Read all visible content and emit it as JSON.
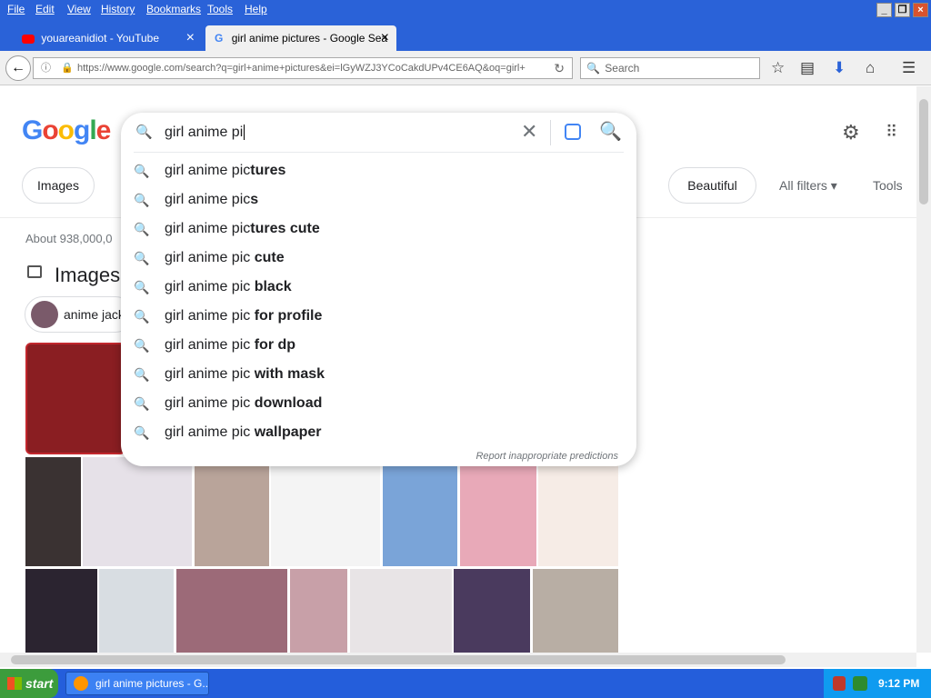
{
  "menubar": {
    "items": [
      "File",
      "Edit",
      "View",
      "History",
      "Bookmarks",
      "Tools",
      "Help"
    ]
  },
  "tabs": [
    {
      "title": "youareanidiot - YouTube",
      "close": "×"
    },
    {
      "title": "girl anime pictures - Google Sea",
      "close": "×"
    }
  ],
  "nav": {
    "back_glyph": "←",
    "url": "https://www.google.com/search?q=girl+anime+pictures&ei=lGyWZJ3YCoCakdUPv4CE6AQ&oq=girl+",
    "search_placeholder": "Search"
  },
  "google": {
    "logo": "Google",
    "chips": [
      "Images",
      "Beautiful"
    ],
    "all_filters": "All filters",
    "tools": "Tools",
    "about": "About 938,000,0",
    "images_heading": "Images",
    "anime_chip": "anime jack"
  },
  "autocomplete": {
    "query": "girl anime pi",
    "suggestions": [
      {
        "base": "girl anime pic",
        "bold": "tures"
      },
      {
        "base": "girl anime pic",
        "bold": "s"
      },
      {
        "base": "girl anime pic",
        "bold": "tures cute"
      },
      {
        "base": "girl anime pic",
        "bold": " cute"
      },
      {
        "base": "girl anime pic",
        "bold": " black"
      },
      {
        "base": "girl anime pic",
        "bold": " for profile"
      },
      {
        "base": "girl anime pic",
        "bold": " for dp"
      },
      {
        "base": "girl anime pic",
        "bold": " with mask"
      },
      {
        "base": "girl anime pic",
        "bold": " download"
      },
      {
        "base": "girl anime pic",
        "bold": " wallpaper"
      }
    ],
    "report": "Report inappropriate predictions"
  },
  "taskbar": {
    "start": "start",
    "item": "girl anime pictures - G...",
    "clock": "9:12 PM"
  },
  "colors": {
    "xp_blue": "#2a62d8",
    "google_blue": "#4285f4",
    "start_green": "#3c9c3c"
  }
}
